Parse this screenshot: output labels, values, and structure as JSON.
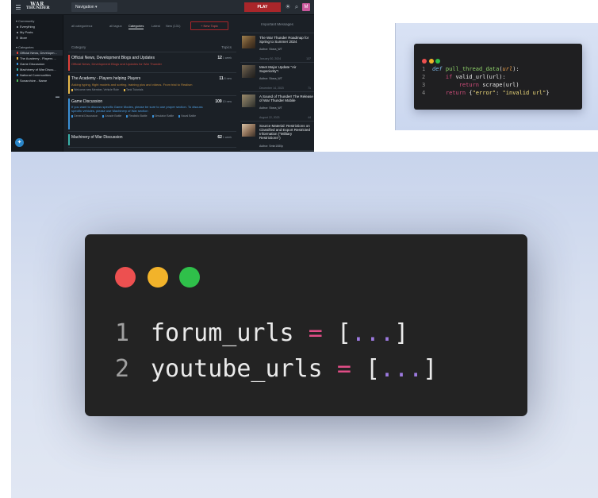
{
  "forum": {
    "topbar": {
      "logo_line1": "WAR",
      "logo_line2": "THUNDER",
      "navigation_label": "Navigation ▾",
      "play_label": "PLAY",
      "avatar_letter": "M"
    },
    "sidebar": {
      "community_header": "Community",
      "community_items": [
        "Everything",
        "My Posts",
        "More"
      ],
      "categories_header": "Categories",
      "category_items": [
        {
          "label": "Official News, Developm...",
          "color": "#e0403a"
        },
        {
          "label": "The Academy - Players ...",
          "color": "#e6b84a"
        },
        {
          "label": "Game Discussion",
          "color": "#3a8fd6"
        },
        {
          "label": "Machinery of War Discu...",
          "color": "#3ab0a8"
        },
        {
          "label": "National Communities",
          "color": "#3a8fd6"
        },
        {
          "label": "Sonarchive - Name",
          "color": "#4fb35a"
        }
      ]
    },
    "filters": {
      "all_categories": "all categories ▸",
      "all_tags": "all tags ▸",
      "tab_categories": "Categories",
      "tab_latest": "Latest",
      "tab_new": "New (131)",
      "new_topic": "+ New Topic"
    },
    "table_header": {
      "category": "Category",
      "topics": "Topics"
    },
    "categories": [
      {
        "title": "Official News, Development Blogs and Updates",
        "desc": "Official News, Development Blogs and Updates for War Thunder",
        "count": "12",
        "per": "1 week",
        "color": "#e0403a",
        "desc_color": "#c9463f",
        "subs": []
      },
      {
        "title": "The Academy - Players helping Players",
        "desc": "Asking typing, flight models and sorting, training pics and videos. From trial to Realism",
        "count": "11",
        "per": "8 new",
        "color": "#e6b84a",
        "desc_color": "#c08a3a",
        "subs": [
          "Welcome new Member, Vehicle Role",
          "Tank Tutorials"
        ]
      },
      {
        "title": "Game Discussion",
        "desc": "If you want to discuss specific Game Modes, please be sure to use proper section. To discuss specific vehicles, please use Machinery of War section",
        "count": "109",
        "per": "10 new",
        "color": "#3a8fd6",
        "desc_color": "#4f9ee0",
        "subs": [
          "General Discussion",
          "Arcade Battle",
          "Realistic Battle",
          "Simulator Battle",
          "Naval Battle"
        ]
      },
      {
        "title": "Machinery of War Discussion",
        "desc": "",
        "count": "62",
        "per": "1 week",
        "color": "#3ab0a8",
        "desc_color": "#4fb3aa",
        "subs": []
      }
    ],
    "important": {
      "title": "Important Messages",
      "items": [
        {
          "title": "The War Thunder Roadmap for Spring to Summer 2024",
          "author": "Author: Stona_WT",
          "date": "January 30, 2024",
          "count": "137"
        },
        {
          "title": "Meet Major Update “Air Superiority”!",
          "author": "Author: Stona_WT",
          "date": "December 14, 2023",
          "count": "71"
        },
        {
          "title": "A Sound of Thunder! The Release of War Thunder Mobile",
          "author": "Author: Stona_WT",
          "date": "August 22, 2023",
          "count": "44"
        },
        {
          "title": "Source Material: Restrictions on Classified and Export Restricted Information (\"Military Restrictions\")",
          "author": "Author: Smin1080p",
          "date": "June 22, 2023",
          "count": "5"
        }
      ]
    }
  },
  "small_code": {
    "lines": [
      {
        "n": "1",
        "code": "def pull_thread_data(url):"
      },
      {
        "n": "2",
        "code": "if valid_url(url):"
      },
      {
        "n": "3",
        "code": "return scrape(url)"
      },
      {
        "n": "4",
        "code": "return {\"error\": \"invalid url\"}"
      }
    ],
    "tokens": {
      "def": "def",
      "fn_name": "pull_thread_data",
      "paren_open": "(",
      "param": "url",
      "paren_close": "):",
      "if": "if",
      "valid": "valid_url(url):",
      "return1": "return",
      "scrape": "scrape(url)",
      "return2": "return",
      "brace_open": "{",
      "key": "\"error\"",
      "colon": ": ",
      "val": "\"invalid url\"",
      "brace_close": "}"
    }
  },
  "big_code": {
    "lines": [
      {
        "n": "1",
        "var": "forum_urls",
        "op": "=",
        "open": "[",
        "ellipsis": "...",
        "close": "]"
      },
      {
        "n": "2",
        "var": "youtube_urls",
        "op": "=",
        "open": "[",
        "ellipsis": "...",
        "close": "]"
      }
    ]
  },
  "colors": {
    "dot_red": "#ed5050",
    "dot_yellow": "#f2b32a",
    "dot_green": "#2fc04a",
    "play_red": "#a9262a"
  }
}
